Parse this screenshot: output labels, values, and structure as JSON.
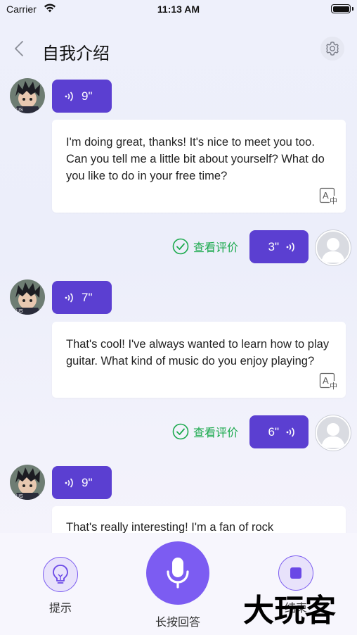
{
  "status_bar": {
    "carrier": "Carrier",
    "time": "11:13 AM"
  },
  "nav": {
    "title": "自我介绍"
  },
  "messages": [
    {
      "role": "ai",
      "duration": "9\"",
      "text": "I'm doing great, thanks! It's nice to meet you too. Can you tell me a little bit about yourself? What do you like to do in your free time?"
    },
    {
      "role": "user",
      "duration": "3\"",
      "review_label": "查看评价"
    },
    {
      "role": "ai",
      "duration": "7\"",
      "text": "That's cool! I've always wanted to learn how to play guitar. What kind of music do you enjoy playing?"
    },
    {
      "role": "user",
      "duration": "6\"",
      "review_label": "查看评价"
    },
    {
      "role": "ai",
      "duration": "9\"",
      "text": "That's really interesting! I'm a fan of rock"
    }
  ],
  "bottom_bar": {
    "hint_label": "提示",
    "mic_label": "长按回答",
    "stop_label": "结束",
    "watermark": "大玩客"
  },
  "colors": {
    "accent": "#5b3fd1",
    "mic": "#7c5cf2",
    "review_green": "#1aa94c"
  },
  "icons": [
    "back-chevron-icon",
    "settings-gear-icon",
    "voice-wave-icon",
    "translate-icon",
    "check-circle-icon",
    "lightbulb-icon",
    "microphone-icon",
    "stop-icon"
  ]
}
